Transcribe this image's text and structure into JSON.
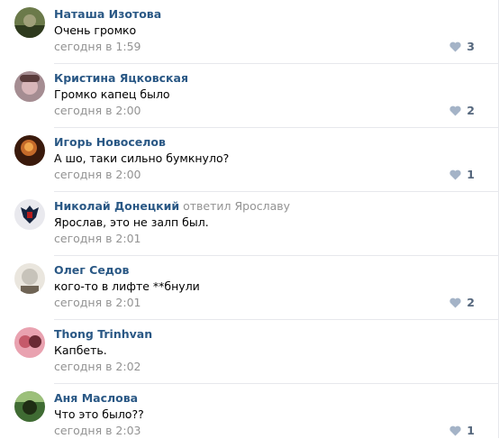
{
  "comments": [
    {
      "author": "Наташа Изотова",
      "text": "Очень громко",
      "date": "сегодня в 1:59",
      "likes": "3",
      "avatar": {
        "name": "avatar",
        "colors": [
          "#6b7a4a",
          "#2e3a1e",
          "#a0a07a"
        ]
      }
    },
    {
      "author": "Кристина Яцковская",
      "text": "Громко капец было",
      "date": "сегодня в 2:00",
      "likes": "2",
      "avatar": {
        "name": "avatar",
        "colors": [
          "#a58d92",
          "#5a3c3c",
          "#d8b6b9"
        ]
      }
    },
    {
      "author": "Игорь Новоселов",
      "text": "А шо, таки сильно бумкнуло?",
      "date": "сегодня в 2:00",
      "likes": "1",
      "avatar": {
        "name": "avatar",
        "colors": [
          "#c46a2a",
          "#3a1a0c",
          "#f0a64c"
        ]
      }
    },
    {
      "author": "Николай Донецкий",
      "reply_word": "ответил",
      "reply_to": "Ярославу",
      "text": "Ярослав, это не залп был.",
      "date": "сегодня в 2:01",
      "likes": "",
      "avatar": {
        "name": "coat-of-arms-icon",
        "colors": [
          "#e9e9ee",
          "#15243f",
          "#b51d1d"
        ]
      }
    },
    {
      "author": "Олег Седов",
      "text": "кого-то в лифте **бнули",
      "date": "сегодня в 2:01",
      "likes": "2",
      "avatar": {
        "name": "avatar",
        "colors": [
          "#c7c3ba",
          "#6f6455",
          "#eae6de"
        ]
      }
    },
    {
      "author": "Thong Trinhvan",
      "text": "Капбеть.",
      "date": "сегодня в 2:02",
      "likes": "",
      "avatar": {
        "name": "avatar",
        "colors": [
          "#c55a6a",
          "#6a2a34",
          "#e9a2b0"
        ]
      }
    },
    {
      "author": "Аня Маслова",
      "text": "Что это было??",
      "date": "сегодня в 2:03",
      "likes": "1",
      "avatar": {
        "name": "avatar",
        "colors": [
          "#3f6b33",
          "#1f2d14",
          "#9cc07a"
        ]
      }
    }
  ],
  "colors": {
    "link": "#2a5885",
    "meta": "#939393",
    "like": "#55677d",
    "heart": "#a4b3c7",
    "divider": "#e7e8ec"
  }
}
